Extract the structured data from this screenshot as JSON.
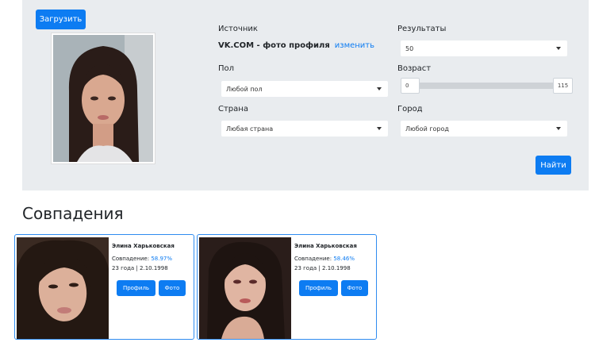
{
  "upload_button": "Загрузить",
  "search": {
    "source_label": "Источник",
    "source_value": "VK.COM - фото профиля",
    "source_change": "изменить",
    "results_label": "Результаты",
    "results_value": "50",
    "gender_label": "Пол",
    "gender_value": "Любой пол",
    "age_label": "Возраст",
    "age_min": "0",
    "age_max": "115",
    "country_label": "Страна",
    "country_value": "Любая страна",
    "city_label": "Город",
    "city_value": "Любой город",
    "find_button": "Найти"
  },
  "matches_title": "Совпадения",
  "matches": [
    {
      "name": "Элина Харьковская",
      "match_label": "Совпадение:",
      "match_value": "58.97%",
      "age_birth": "23 года | 2.10.1998",
      "profile_button": "Профиль",
      "photo_button": "Фото"
    },
    {
      "name": "Элина Харьковская",
      "match_label": "Совпадение:",
      "match_value": "58.46%",
      "age_birth": "23 года | 2.10.1998",
      "profile_button": "Профиль",
      "photo_button": "Фото"
    }
  ],
  "colors": {
    "primary": "#0d7cf2",
    "panel_bg": "#e9ecef",
    "card_border": "#2f8cf0"
  },
  "icons": [
    "caret-down-icon"
  ]
}
